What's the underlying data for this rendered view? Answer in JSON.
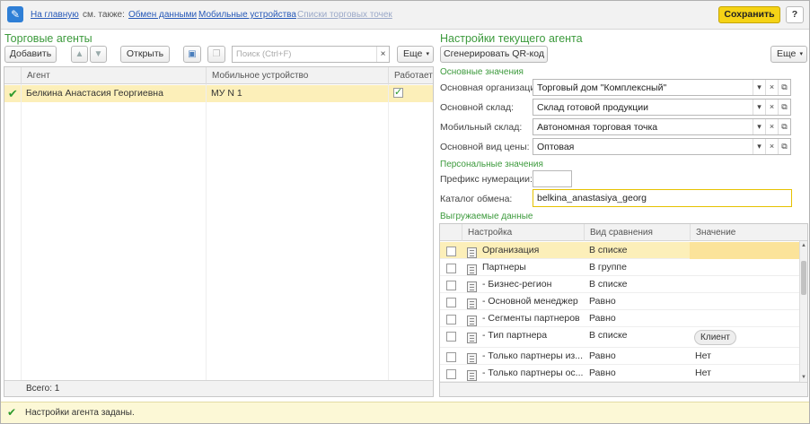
{
  "topbar": {
    "home_link": "На главную",
    "see_also": "см. также:",
    "link_exchange": "Обмен данными",
    "link_mobile": "Мобильные устройства",
    "link_points": "Списки торговых точек",
    "save_label": "Сохранить",
    "help_label": "?"
  },
  "left": {
    "title": "Торговые агенты",
    "add_label": "Добавить",
    "open_label": "Открыть",
    "search_placeholder": "Поиск (Ctrl+F)",
    "more_label": "Еще",
    "columns": [
      "Агент",
      "Мобильное устройство",
      "Работает"
    ],
    "rows": [
      {
        "agent": "Белкина Анастасия Георгиевна",
        "device": "МУ N 1",
        "works": true
      }
    ],
    "total": "Всего: 1"
  },
  "right": {
    "title": "Настройки текущего агента",
    "qr_label": "Сгенерировать QR-код",
    "more_label": "Еще",
    "main_values_title": "Основные значения",
    "fields": [
      {
        "label": "Основная организация:",
        "value": "Торговый дом \"Комплексный\""
      },
      {
        "label": "Основной склад:",
        "value": "Склад готовой продукции"
      },
      {
        "label": "Мобильный склад:",
        "value": "Автономная торговая точка"
      },
      {
        "label": "Основной вид цены:",
        "value": "Оптовая"
      }
    ],
    "personal_title": "Персональные значения",
    "prefix_label": "Префикс нумерации:",
    "prefix_value": "",
    "catalog_label": "Каталог обмена:",
    "catalog_value": "belkina_anastasiya_georg",
    "export_title": "Выгружаемые данные",
    "export_columns": [
      "Настройка",
      "Вид сравнения",
      "Значение"
    ],
    "export_rows": [
      {
        "name": "Организация",
        "cmp": "В списке",
        "value": ""
      },
      {
        "name": "Партнеры",
        "cmp": "В группе",
        "value": ""
      },
      {
        "name": "- Бизнес-регион",
        "cmp": "В списке",
        "value": ""
      },
      {
        "name": "- Основной менеджер",
        "cmp": "Равно",
        "value": ""
      },
      {
        "name": "- Сегменты партнеров",
        "cmp": "Равно",
        "value": ""
      },
      {
        "name": "- Тип партнера",
        "cmp": "В списке",
        "value": "Клиент"
      },
      {
        "name": "- Только партнеры из...",
        "cmp": "Равно",
        "value": "Нет"
      },
      {
        "name": "- Только партнеры ос...",
        "cmp": "Равно",
        "value": "Нет"
      }
    ]
  },
  "status": {
    "text": "Настройки агента заданы."
  },
  "colors": {
    "accent_green": "#3c9a3c",
    "save_yellow": "#f5d316",
    "selection": "#fcefb9"
  }
}
